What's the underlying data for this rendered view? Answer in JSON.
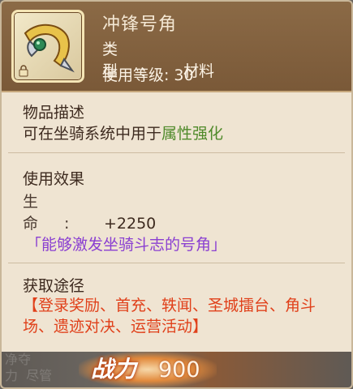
{
  "item": {
    "name": "冲锋号角",
    "type_label": "类型:",
    "type_value": "材料",
    "level_label": "使用等级:",
    "level_value": "30",
    "icon": "horn-icon",
    "locked_icon": "lock-icon"
  },
  "description": {
    "title": "物品描述",
    "text_prefix": "可在坐骑系统中用于",
    "text_highlight": "属性强化"
  },
  "effect": {
    "title": "使用效果",
    "stat_label": "生命:",
    "stat_value": "+2250",
    "flavor": "「能够激发坐骑斗志的号角」"
  },
  "acquire": {
    "title": "获取途径",
    "text": "【登录奖励、首充、轶闻、圣城擂台、角斗场、遗迹对决、运营活动】"
  },
  "footer": {
    "power_label": "战力",
    "power_value": "900",
    "ghost_text": "净夺\n力  尽管"
  },
  "colors": {
    "header_bg": "#7a5938",
    "panel_bg": "#efe4d2",
    "highlight_green": "#4f8a2a",
    "flavor_purple": "#8a3fd1",
    "source_red": "#e0401a"
  }
}
